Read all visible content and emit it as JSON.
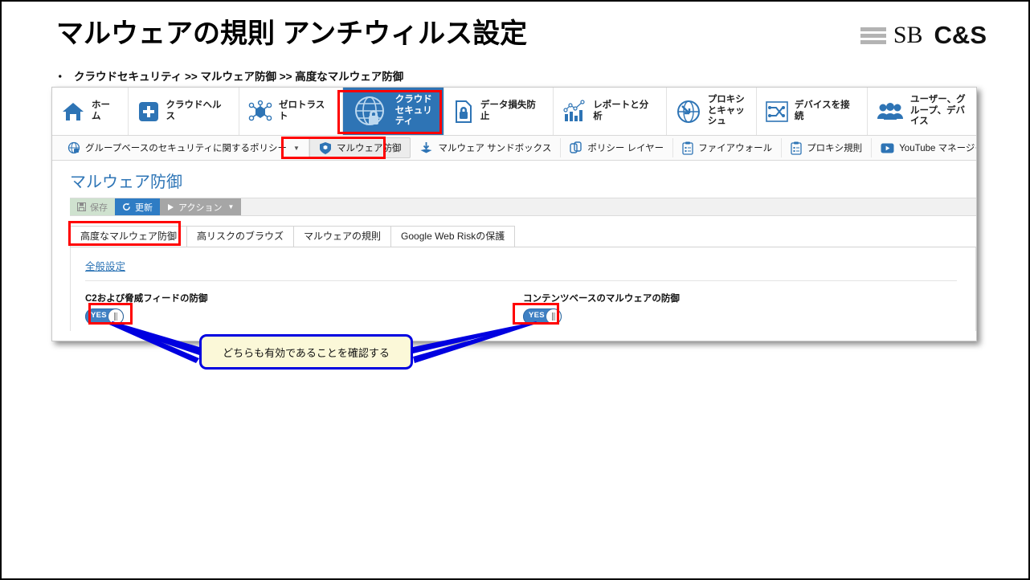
{
  "slide": {
    "title": "マルウェアの規則 アンチウィルス設定",
    "breadcrumb": "クラウドセキュリティ >> マルウェア防御 >> 高度なマルウェア防御",
    "bullet": "・",
    "logo": {
      "sb": "SB",
      "cs": "C&S"
    },
    "callout": "どちらも有効であることを確認する",
    "colors": {
      "accent_blue": "#2e74b5",
      "annotation_red": "#ff0000",
      "callout_border": "#0000e0",
      "callout_fill": "#fbf8d8",
      "toggle_on": "#3f80c3"
    }
  },
  "app": {
    "top_nav": [
      {
        "label": "ホーム",
        "icon": "home-icon",
        "active": false
      },
      {
        "label": "クラウドヘルス",
        "icon": "plus-cross-icon",
        "active": false
      },
      {
        "label": "ゼロトラスト",
        "icon": "network-nodes-icon",
        "active": false
      },
      {
        "label": "クラウドセキュリティ",
        "icon": "globe-lock-icon",
        "active": true
      },
      {
        "label": "データ損失防止",
        "icon": "document-lock-icon",
        "active": false
      },
      {
        "label": "レポートと分析",
        "icon": "bar-chart-icon",
        "active": false
      },
      {
        "label": "プロキシとキャッシュ",
        "icon": "globe-arrow-icon",
        "active": false
      },
      {
        "label": "デバイスを接続",
        "icon": "shuffle-icon",
        "active": false
      },
      {
        "label": "ユーザー、グループ、デバイス",
        "icon": "users-icon",
        "active": false
      }
    ],
    "sub_nav": [
      {
        "label": "グループベースのセキュリティに関するポリシー",
        "icon": "globe-lock-small-icon",
        "caret": "▼",
        "selected": false
      },
      {
        "label": "マルウェア防御",
        "icon": "shield-icon",
        "selected": true
      },
      {
        "label": "マルウェア サンドボックス",
        "icon": "sandbox-icon",
        "selected": false
      },
      {
        "label": "ポリシー レイヤー",
        "icon": "layers-icon",
        "selected": false
      },
      {
        "label": "ファイアウォール",
        "icon": "clipboard-icon",
        "selected": false
      },
      {
        "label": "プロキシ規則",
        "icon": "clipboard-icon",
        "selected": false
      },
      {
        "label": "YouTube マネージャー",
        "icon": "video-icon",
        "selected": false
      },
      {
        "label": "",
        "icon": "truncated-icon",
        "selected": false
      }
    ],
    "page": {
      "title": "マルウェア防御",
      "toolbar": [
        {
          "label": "保存",
          "icon": "save-icon"
        },
        {
          "label": "更新",
          "icon": "refresh-icon"
        },
        {
          "label": "アクション",
          "icon": "play-icon",
          "caret": "▼"
        }
      ],
      "tabs": [
        {
          "label": "高度なマルウェア防御",
          "active": true
        },
        {
          "label": "高リスクのブラウズ",
          "active": false
        },
        {
          "label": "マルウェアの規則",
          "active": false
        },
        {
          "label": "Google Web Riskの保護",
          "active": false
        }
      ],
      "section_title": "全般設定",
      "settings": [
        {
          "label": "C2および脅威フィードの防御",
          "toggle_value": "YES",
          "on": true
        },
        {
          "label": "コンテンツベースのマルウェアの防御",
          "toggle_value": "YES",
          "on": true
        }
      ]
    }
  }
}
